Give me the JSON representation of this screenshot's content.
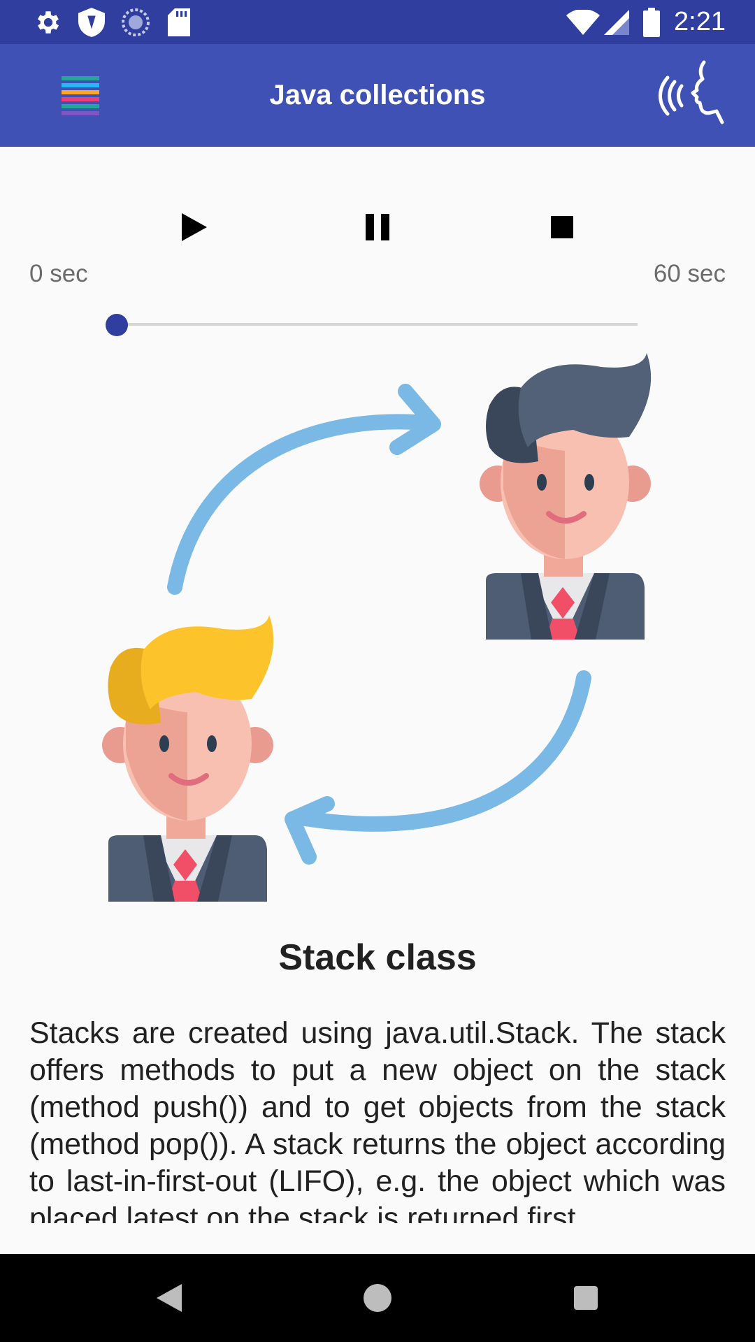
{
  "status_bar": {
    "time": "2:21",
    "left_icons": [
      "gear-icon",
      "shield-icon",
      "sync-icon",
      "sd-card-icon"
    ],
    "right_icons": [
      "wifi-icon",
      "signal-icon",
      "battery-icon"
    ]
  },
  "app_bar": {
    "title": "Java collections",
    "left_icon": "menu-icon",
    "right_icon": "voice-speak-icon",
    "color": "#3f51b5"
  },
  "player": {
    "start_label": "0 sec",
    "end_label": "60 sec",
    "progress": 0,
    "controls": [
      "play-icon",
      "pause-icon",
      "stop-icon"
    ],
    "accent": "#303f9f"
  },
  "content": {
    "heading": "Stack class",
    "body": "Stacks are created using java.util.Stack. The stack offers methods to put a new object on the stack (method push()) and to get objects from the stack (method pop()). A stack returns the object according to last-in-first-out (LIFO), e.g. the object which was placed latest on the stack is returned first."
  },
  "nav_bar": {
    "buttons": [
      "back-icon",
      "home-icon",
      "recents-icon"
    ]
  }
}
